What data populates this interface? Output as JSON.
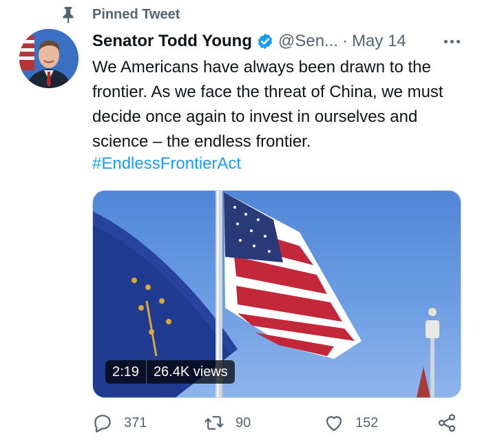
{
  "pinned": {
    "label": "Pinned Tweet"
  },
  "tweet": {
    "author_name": "Senator Todd Young",
    "handle": "@Sen...",
    "separator": "·",
    "date": "May 14",
    "text": "We Americans have always been drawn to the frontier. As we face the threat of China, we must decide once again to invest in ourselves and science – the endless frontier.",
    "hashtag": "#EndlessFrontierAct"
  },
  "media": {
    "duration": "2:19",
    "views": "26.4K views"
  },
  "actions": {
    "replies": "371",
    "retweets": "90",
    "likes": "152"
  },
  "colors": {
    "accent": "#1d9bf0",
    "secondary_text": "#536471",
    "primary_text": "#0f1419"
  },
  "icons": {
    "pin": "pin-icon",
    "verified": "verified-badge-icon",
    "more": "more-options-icon",
    "reply": "reply-icon",
    "retweet": "retweet-icon",
    "like": "heart-icon",
    "share": "share-icon"
  }
}
